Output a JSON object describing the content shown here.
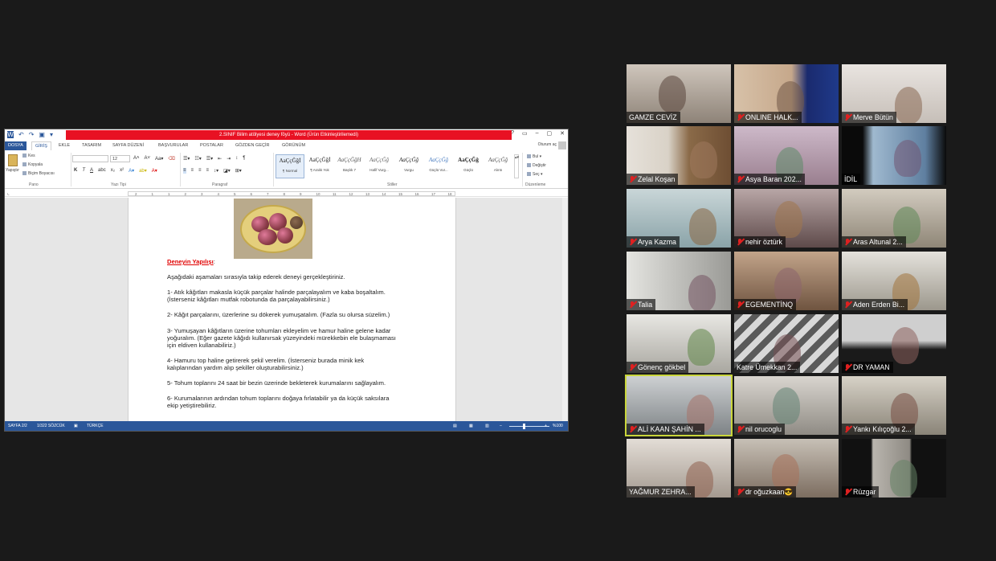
{
  "word": {
    "title": "2.SINIF Bilim atölyesi deney föyü - Word (Ürün Etkinleştirilemedi)",
    "tabs": [
      "DOSYA",
      "GİRİŞ",
      "EKLE",
      "TASARIM",
      "SAYFA DÜZENİ",
      "BAŞVURULAR",
      "POSTALAR",
      "GÖZDEN GEÇİR",
      "GÖRÜNÜM"
    ],
    "sign_in": "Oturum aç",
    "clipboard": {
      "paste": "Yapıştır",
      "cut": "Kes",
      "copy": "Kopyala",
      "format_painter": "Biçim Boyacısı",
      "label": "Pano"
    },
    "font": {
      "name": "",
      "size": "12",
      "label": "Yazı Tipi"
    },
    "paragraph_label": "Paragraf",
    "styles": [
      {
        "sample": "AaÇçĞğİ",
        "name": "¶ Normal"
      },
      {
        "sample": "AaÇçĞğİ",
        "name": "¶ Aralık Yok"
      },
      {
        "sample": "AaÇçĞğH",
        "name": "Başlık 7"
      },
      {
        "sample": "AaÇçĞğ",
        "name": "Hafif Vurg..."
      },
      {
        "sample": "AaÇçĞğ",
        "name": "Vurgu"
      },
      {
        "sample": "AaÇçĞğ",
        "name": "Güçlü Vur..."
      },
      {
        "sample": "AaÇçĞğ",
        "name": "Güçlü"
      },
      {
        "sample": "AaÇçĞğ",
        "name": "Alıntı"
      }
    ],
    "styles_label": "Stiller",
    "editing": {
      "find": "Bul",
      "replace": "Değiştir",
      "select": "Seç",
      "label": "Düzenleme"
    },
    "ruler_ticks": [
      "2",
      "1",
      "1",
      "2",
      "3",
      "4",
      "5",
      "6",
      "7",
      "8",
      "9",
      "10",
      "11",
      "12",
      "13",
      "14",
      "15",
      "16",
      "17",
      "18"
    ],
    "doc": {
      "heading": "Deneyin Yapılışı",
      "heading_suffix": ":",
      "lines": [
        "Aşağıdaki aşamaları sırasıyla takip ederek deneyi gerçekleştiriniz.",
        "1- Atık kâğıtları makasla küçük parçalar halinde parçalayalım ve kaba boşaltalım.",
        "(İsterseniz kâğıtları mutfak robotunda da parçalayabilirsiniz.)",
        "2- Kâğıt parçalarını, üzerlerine su dökerek yumuşatalım. (Fazla su olursa süzelim.)",
        "3- Yumuşayan kâğıtların üzerine tohumları ekleyelim ve hamur haline gelene kadar",
        "yoğuralım. (Eğer gazete kâğıdı kullanırsak yüzeyindeki mürekkebin ele bulaşmaması",
        "için eldiven kullanabiliriz.)",
        "4- Hamuru top haline getirerek şekil verelim. (İsterseniz burada minik kek",
        "kalıplarından yardım alıp şekiller oluşturabilirsiniz.)",
        "5- Tohum toplarını 24 saat bir bezin üzerinde bekleterek kurumalarını sağlayalım.",
        "6-  Kurumalarının ardından tohum toplarını doğaya fırlatabilir ya da küçük saksılara",
        "ekip yetiştirebiliriz."
      ]
    },
    "status": {
      "page": "SAYFA 2/2",
      "words": "1/322 SÖZCÜK",
      "language": "TÜRKÇE",
      "zoom": "%100"
    }
  },
  "participants": [
    {
      "name": "GAMZE CEVİZ",
      "muted": false
    },
    {
      "name": "ONLINE HALK...",
      "muted": true
    },
    {
      "name": "Merve Bütün",
      "muted": true
    },
    {
      "name": "Zelal Koşan",
      "muted": true
    },
    {
      "name": "Asya Baran    202...",
      "muted": true
    },
    {
      "name": "İDİL",
      "muted": false
    },
    {
      "name": "Arya Kazma",
      "muted": true
    },
    {
      "name": "nehir öztürk",
      "muted": true
    },
    {
      "name": "Aras Altunal 2...",
      "muted": true
    },
    {
      "name": "Talia",
      "muted": true
    },
    {
      "name": "EGEMENTİNQ",
      "muted": true
    },
    {
      "name": "Aden Erden Bi...",
      "muted": true
    },
    {
      "name": "Gönenç gökbel",
      "muted": true
    },
    {
      "name": "Katre Ümekkan 2...",
      "muted": false
    },
    {
      "name": "DR YAMAN",
      "muted": true
    },
    {
      "name": "ALİ KAAN ŞAHİN ...",
      "muted": true
    },
    {
      "name": "nil orucoglu",
      "muted": true
    },
    {
      "name": "Yankı Kılıçoğlu 2...",
      "muted": true
    },
    {
      "name": "YAĞMUR ZEHRA...",
      "muted": false
    },
    {
      "name": "dr oğuzkaan😎",
      "muted": true
    },
    {
      "name": "Rüzgar",
      "muted": true
    }
  ],
  "colors": {
    "word_blue": "#2b579a",
    "title_red": "#e81123",
    "active_speaker": "#c9d53a",
    "mute_red": "#e02020"
  }
}
